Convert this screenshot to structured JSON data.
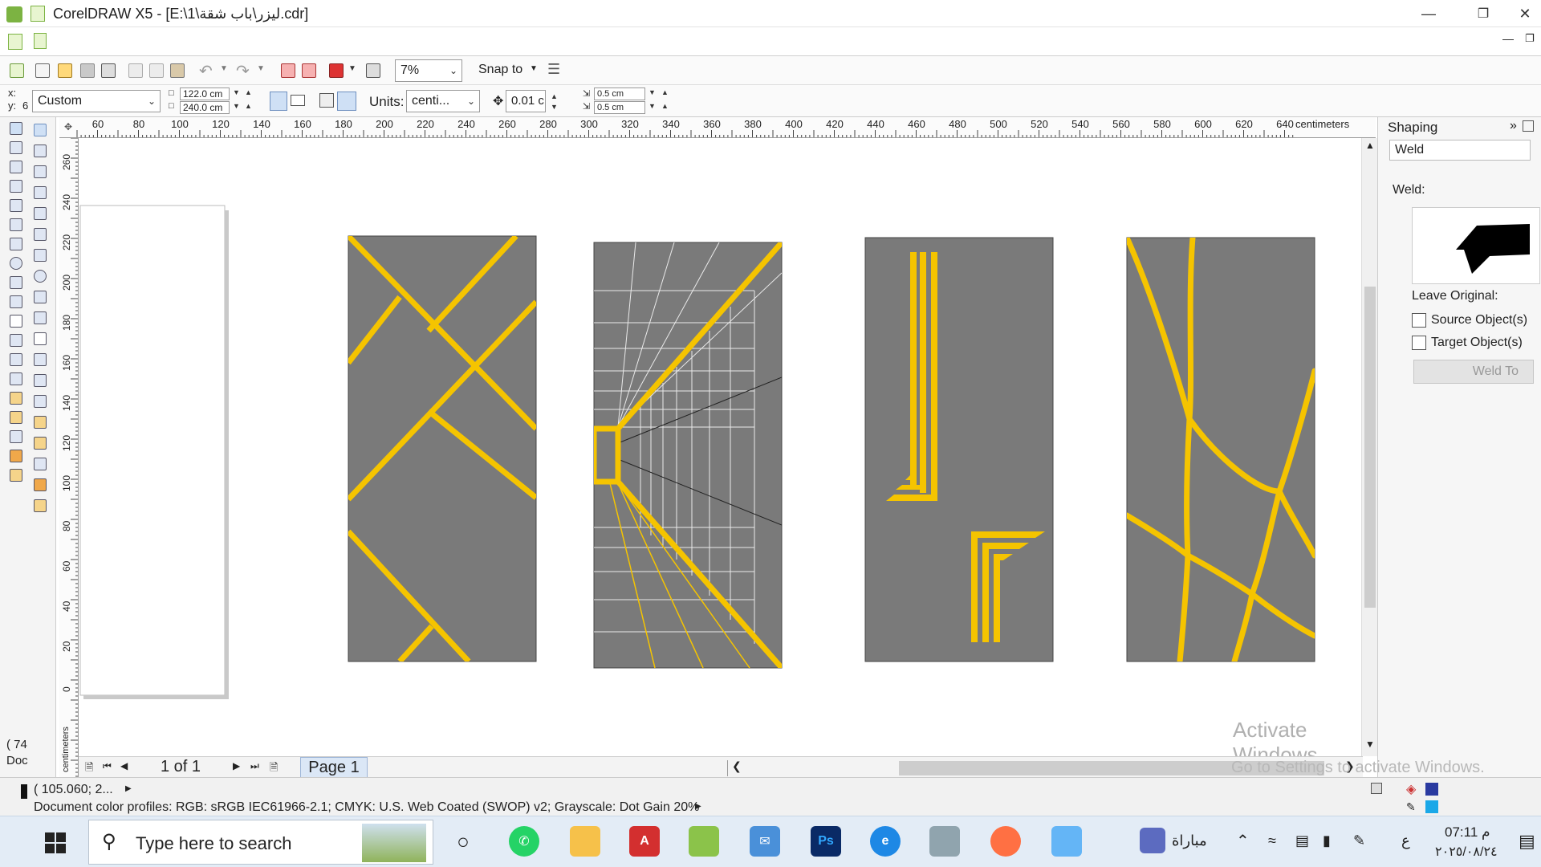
{
  "window": {
    "title": "CorelDRAW X5 - [E:\\1\\ليزر\\باب شقة.cdr]"
  },
  "standard_toolbar": {
    "zoom_value": "7%",
    "snap_to_label": "Snap to"
  },
  "property_bar": {
    "x_label": "x:",
    "y_label": "y:",
    "y_value": "6",
    "page_preset": "Custom",
    "width_value": "122.0 cm",
    "height_value": "240.0 cm",
    "units_label": "Units:",
    "units_value": "centi...",
    "nudge_value": "0.01 c",
    "dup_x_value": "0.5 cm",
    "dup_y_value": "0.5 cm"
  },
  "ruler": {
    "units": "centimeters",
    "h_ticks": [
      "60",
      "80",
      "100",
      "120",
      "140",
      "160",
      "180",
      "200",
      "220",
      "240",
      "260",
      "280",
      "300",
      "320",
      "340",
      "360",
      "380",
      "400",
      "420",
      "440",
      "460",
      "480",
      "500",
      "520",
      "540",
      "560",
      "580",
      "600",
      "620",
      "640"
    ],
    "v_ticks": [
      "260",
      "240",
      "220",
      "200",
      "180",
      "160",
      "140",
      "120",
      "100",
      "80",
      "60",
      "40",
      "20",
      "0"
    ],
    "v_units": "centimeters"
  },
  "canvas": {
    "panel_color": "#7a7a7a",
    "accent_color": "#f5c400"
  },
  "page_nav": {
    "page_count_text": "1 of 1",
    "page_tab_label": "Page 1"
  },
  "docker": {
    "title": "Shaping",
    "mode_value": "Weld",
    "section_label": "Weld:",
    "leave_original_label": "Leave Original:",
    "source_objects_label": "Source Object(s)",
    "target_objects_label": "Target Object(s)",
    "weld_to_button": "Weld To"
  },
  "status": {
    "left_fragment": "( 74",
    "left_fragment2": "Doc",
    "coordinates": "( 105.060; 2...",
    "color_profiles": "Document color profiles: RGB: sRGB IEC61966-2.1; CMYK: U.S. Web Coated (SWOP) v2; Grayscale: Dot Gain 20%"
  },
  "watermark": {
    "activate_title": "Activate Windows",
    "activate_sub": "Go to Settings to activate Windows."
  },
  "taskbar": {
    "search_placeholder": "Type here to search",
    "news_label": "مباراة",
    "lang": "ع",
    "time": "07:11 م",
    "date": "٢٠٢٥/٠٨/٢٤"
  }
}
